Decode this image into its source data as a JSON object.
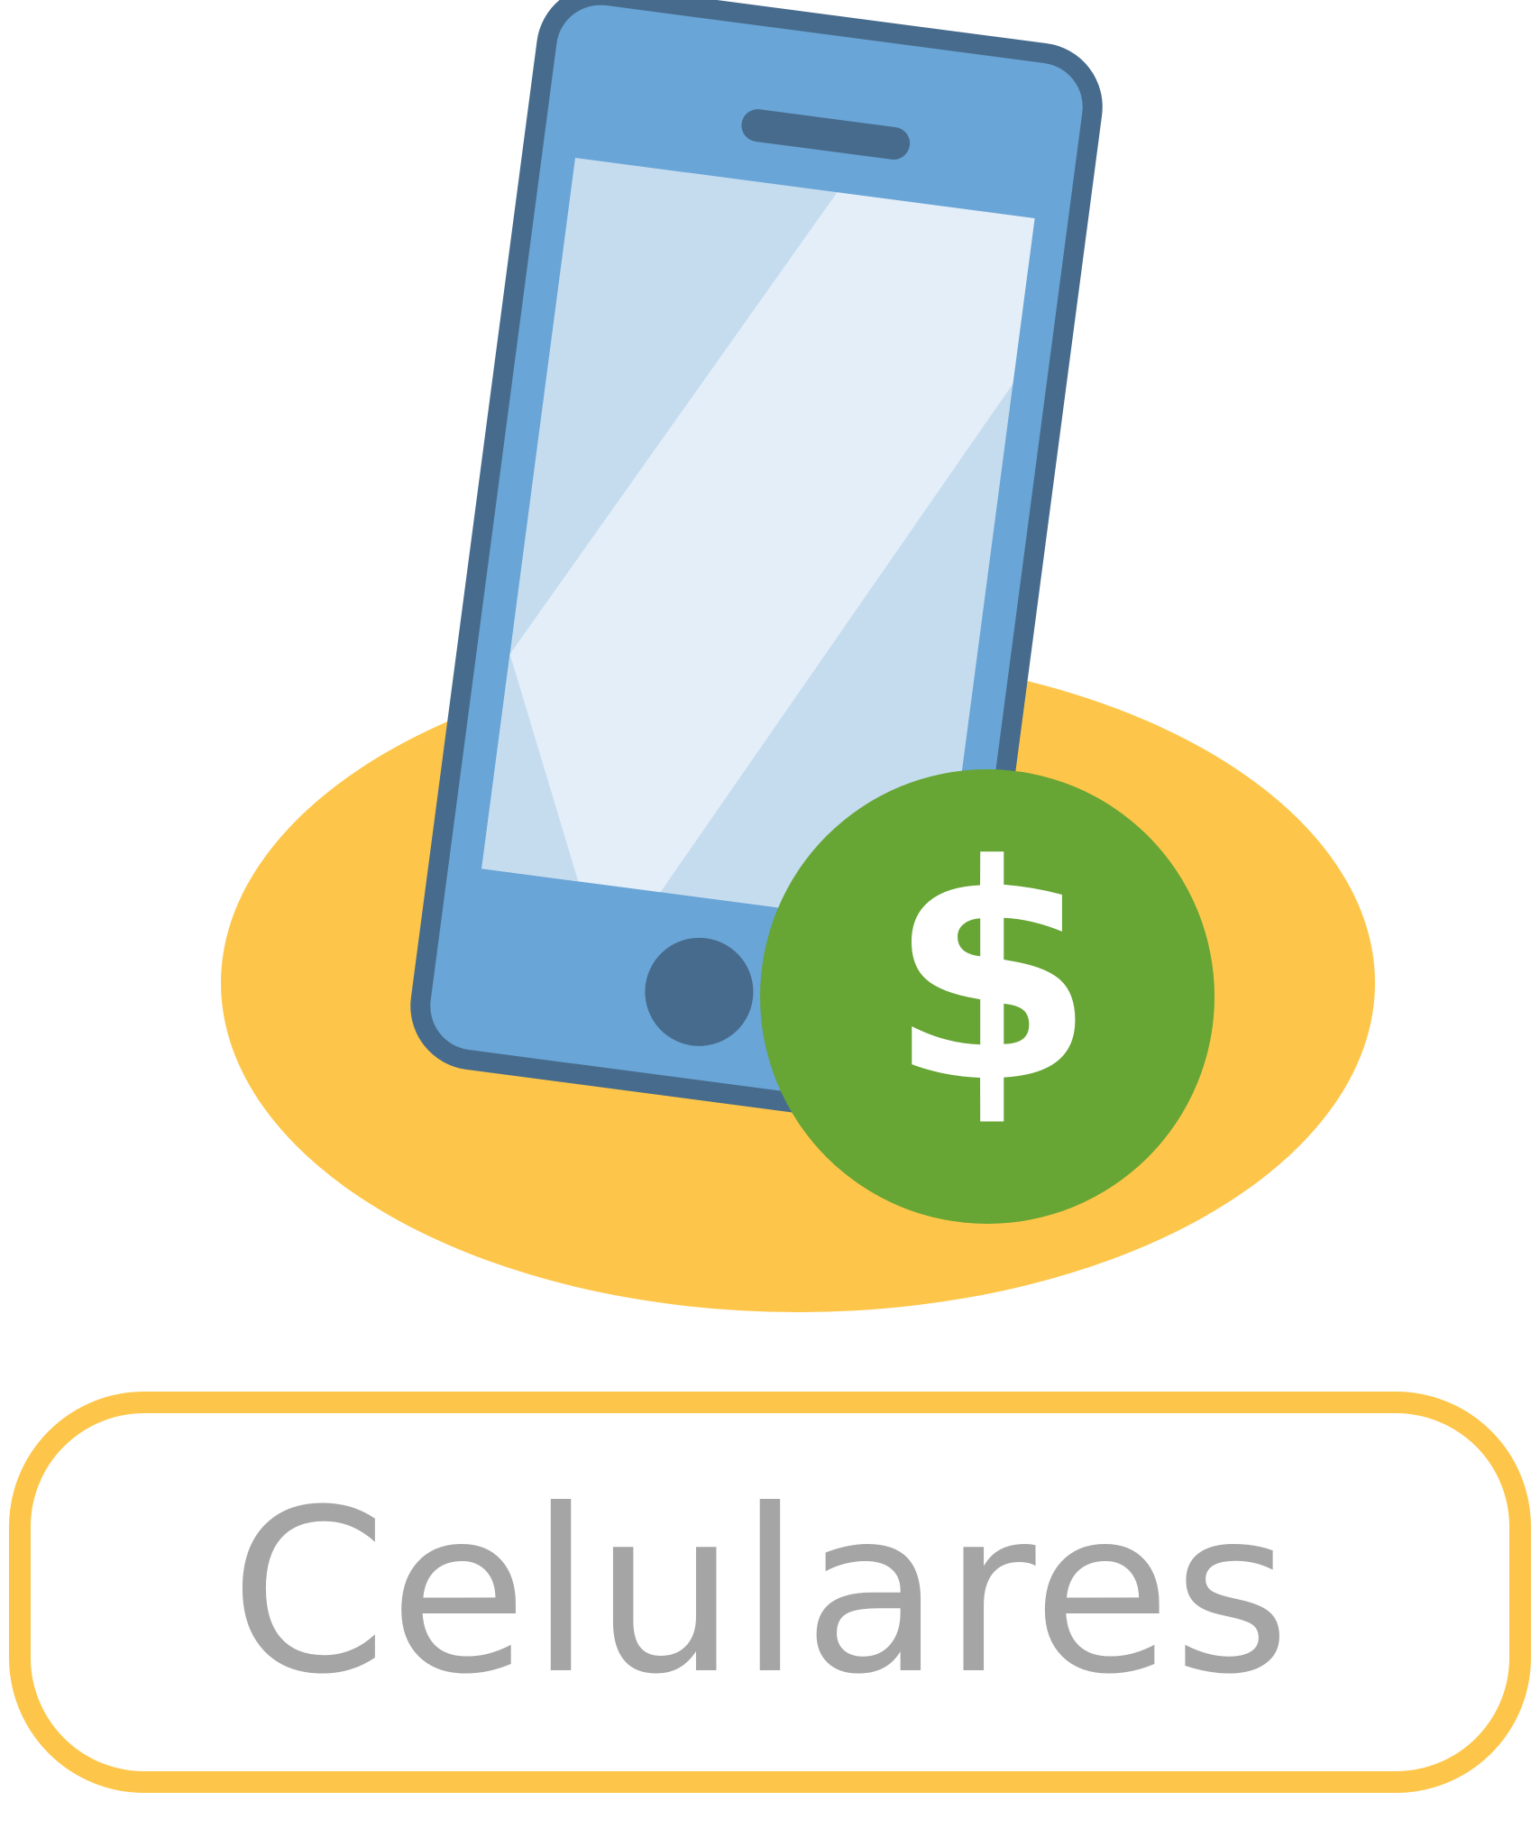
{
  "category": {
    "label": "Celulares"
  },
  "icons": {
    "phone": "mobile-phone-icon",
    "currency": "dollar-sign-icon"
  },
  "colors": {
    "accent_yellow": "#fdc64a",
    "phone_blue": "#69a5d6",
    "phone_outline": "#476b8c",
    "screen": "#c5dcef",
    "screen_glare": "#e3eef8",
    "money_green": "#67a534",
    "label_gray": "#a5a5a5"
  }
}
